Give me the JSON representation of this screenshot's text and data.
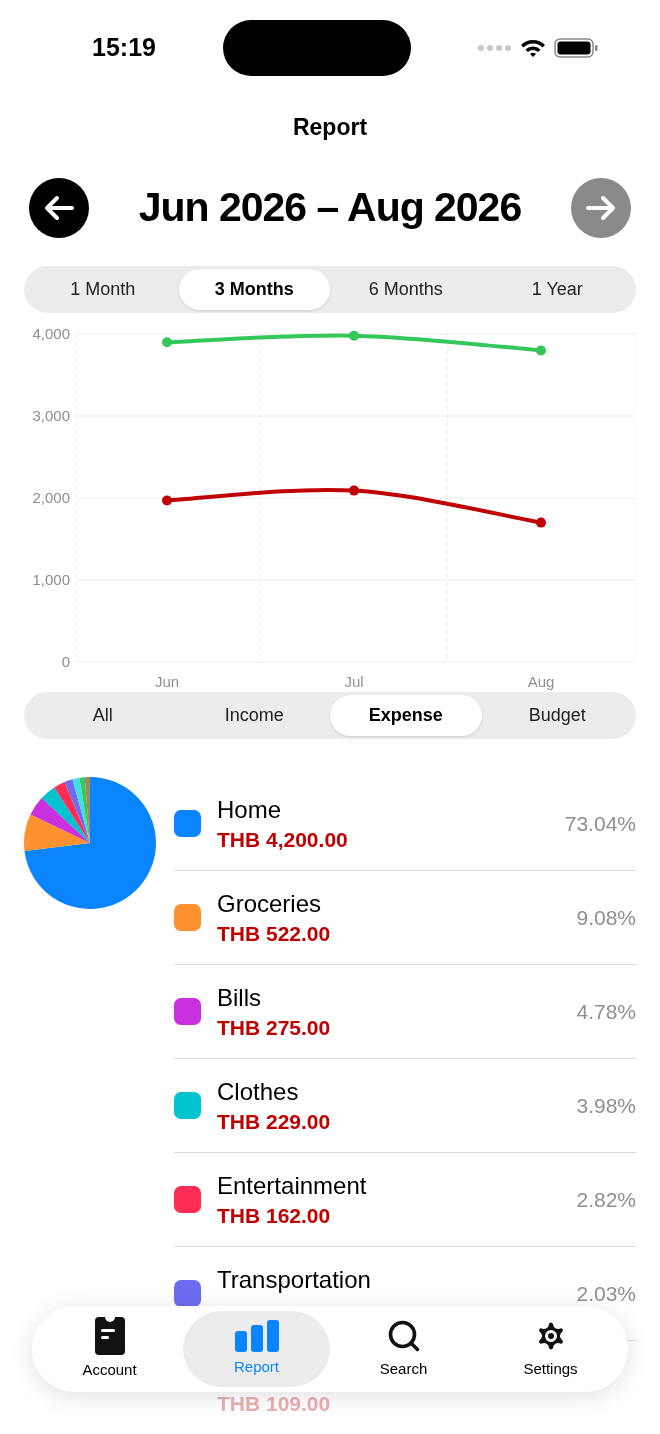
{
  "status_bar": {
    "time": "15:19"
  },
  "title": "Report",
  "period": {
    "label": "Jun 2026 – Aug 2026",
    "prev": {
      "disabled": false
    },
    "next": {
      "disabled": true
    }
  },
  "ranges": [
    {
      "label": "1 Month",
      "selected": false
    },
    {
      "label": "3 Months",
      "selected": true
    },
    {
      "label": "6 Months",
      "selected": false
    },
    {
      "label": "1 Year",
      "selected": false
    }
  ],
  "chart_data": {
    "type": "line",
    "categories": [
      "Jun",
      "Jul",
      "Aug"
    ],
    "ylim": [
      0,
      4000
    ],
    "yticks": [
      {
        "value": 0,
        "label": "0"
      },
      {
        "value": 1000,
        "label": "1,000"
      },
      {
        "value": 2000,
        "label": "2,000"
      },
      {
        "value": 3000,
        "label": "3,000"
      },
      {
        "value": 4000,
        "label": "4,000"
      }
    ],
    "grid": true,
    "series": [
      {
        "color": "#34c759",
        "marker": "o",
        "values": [
          3900,
          3980,
          3800
        ]
      },
      {
        "color": "#c00000",
        "marker": "o",
        "values": [
          1970,
          2090,
          1700
        ]
      }
    ]
  },
  "filters": [
    {
      "label": "All",
      "selected": false
    },
    {
      "label": "Income",
      "selected": false
    },
    {
      "label": "Expense",
      "selected": true
    },
    {
      "label": "Budget",
      "selected": false
    }
  ],
  "categories": [
    {
      "name": "Home",
      "amount": "THB 4,200.00",
      "percent": "73.04%",
      "color": "#0a84ff"
    },
    {
      "name": "Groceries",
      "amount": "THB 522.00",
      "percent": "9.08%",
      "color": "#ff9230"
    },
    {
      "name": "Bills",
      "amount": "THB 275.00",
      "percent": "4.78%",
      "color": "#cb30e0"
    },
    {
      "name": "Clothes",
      "amount": "THB 229.00",
      "percent": "3.98%",
      "color": "#00c3d0"
    },
    {
      "name": "Entertainment",
      "amount": "THB 162.00",
      "percent": "2.82%",
      "color": "#ff2d55"
    },
    {
      "name": "Transportation",
      "percent": "2.03%",
      "color": "#6d6cf0"
    },
    {
      "amount": "THB 109.00"
    }
  ],
  "tab_bar": [
    {
      "label": "Account",
      "selected": false
    },
    {
      "label": "Report",
      "selected": true
    },
    {
      "label": "Search",
      "selected": false
    },
    {
      "label": "Settings",
      "selected": false
    }
  ]
}
